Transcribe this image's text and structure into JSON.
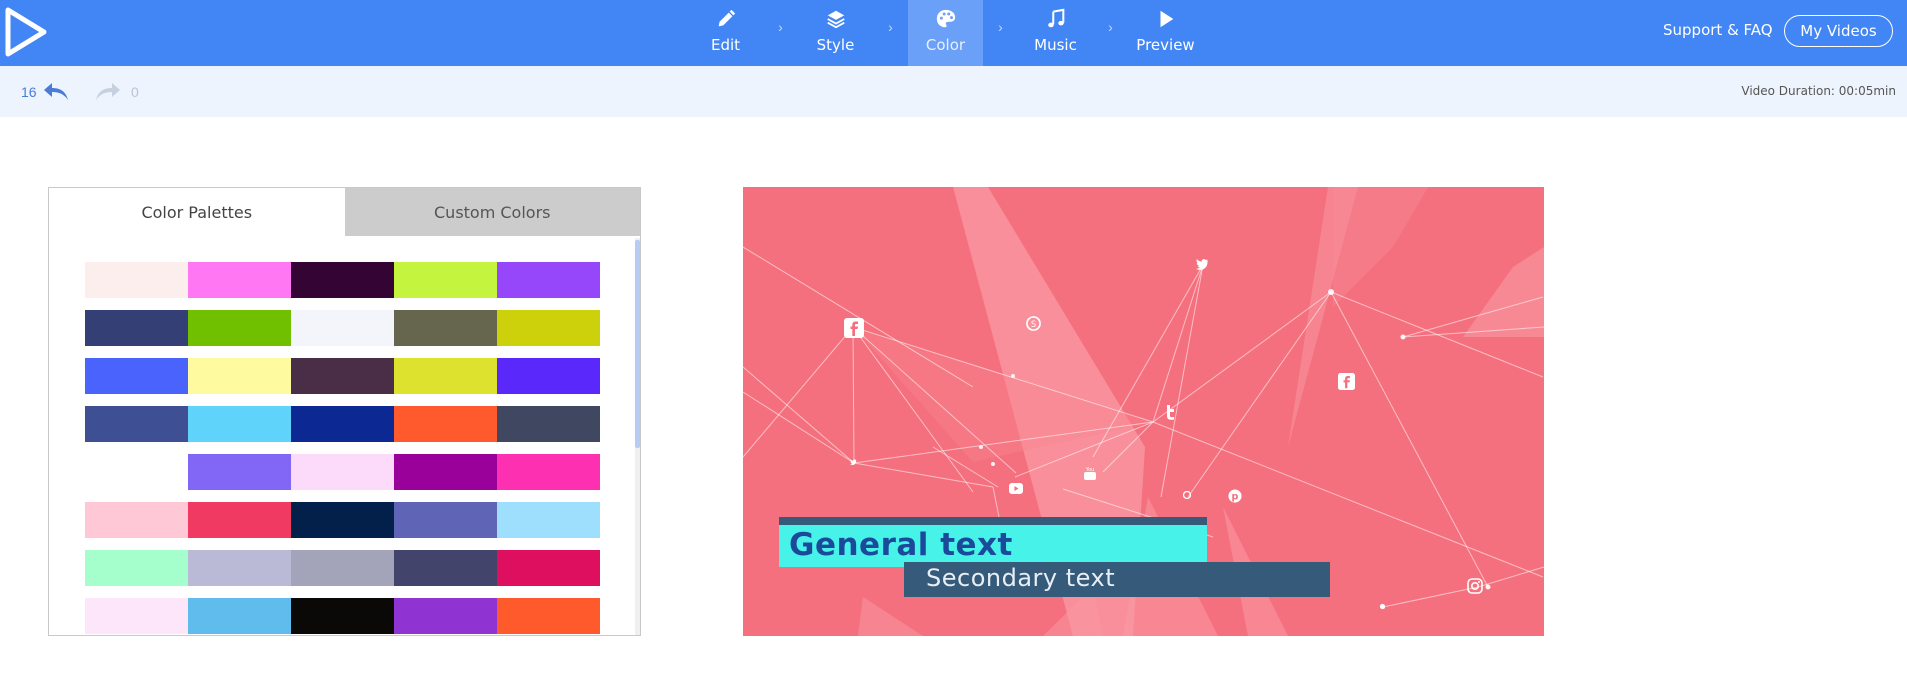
{
  "nav": {
    "steps": [
      {
        "label": "Edit",
        "icon": "pencil-icon",
        "active": false
      },
      {
        "label": "Style",
        "icon": "layers-icon",
        "active": false
      },
      {
        "label": "Color",
        "icon": "palette-icon",
        "active": true
      },
      {
        "label": "Music",
        "icon": "music-note-icon",
        "active": false
      },
      {
        "label": "Preview",
        "icon": "play-icon",
        "active": false
      }
    ],
    "support_label": "Support & FAQ",
    "my_videos_label": "My Videos"
  },
  "toolbar": {
    "undo_count": "16",
    "redo_count": "0",
    "duration": "Video Duration: 00:05min"
  },
  "palette_panel": {
    "tabs": [
      {
        "label": "Color Palettes",
        "active": true
      },
      {
        "label": "Custom Colors",
        "active": false
      }
    ],
    "palettes": [
      [
        "#fdeeee",
        "#ff77f3",
        "#340434",
        "#c4f43e",
        "#9747fa"
      ],
      [
        "#343f76",
        "#71c000",
        "#f3f5fb",
        "#66664f",
        "#cdd10c"
      ],
      [
        "#4a63fc",
        "#fdfaa0",
        "#4a2e48",
        "#dde22e",
        "#5a28fa"
      ],
      [
        "#3e4f93",
        "#60d3fb",
        "#0b2893",
        "#fe5a2d",
        "#404861"
      ],
      [
        "#ffffff",
        "#8267f7",
        "#fbdafa",
        "#9a009a",
        "#fd30b1"
      ],
      [
        "#fec8d6",
        "#f03a62",
        "#03204a",
        "#6064b6",
        "#9ddffd"
      ],
      [
        "#a4ffcd",
        "#bbbad6",
        "#a3a3b9",
        "#42446b",
        "#dd0f5e"
      ],
      [
        "#fde6f9",
        "#5fbced",
        "#0b0808",
        "#8f34d2",
        "#ff5a2c"
      ]
    ]
  },
  "preview": {
    "background_color": "#f5707e",
    "general_text": "General text",
    "secondary_text": "Secondary text"
  }
}
